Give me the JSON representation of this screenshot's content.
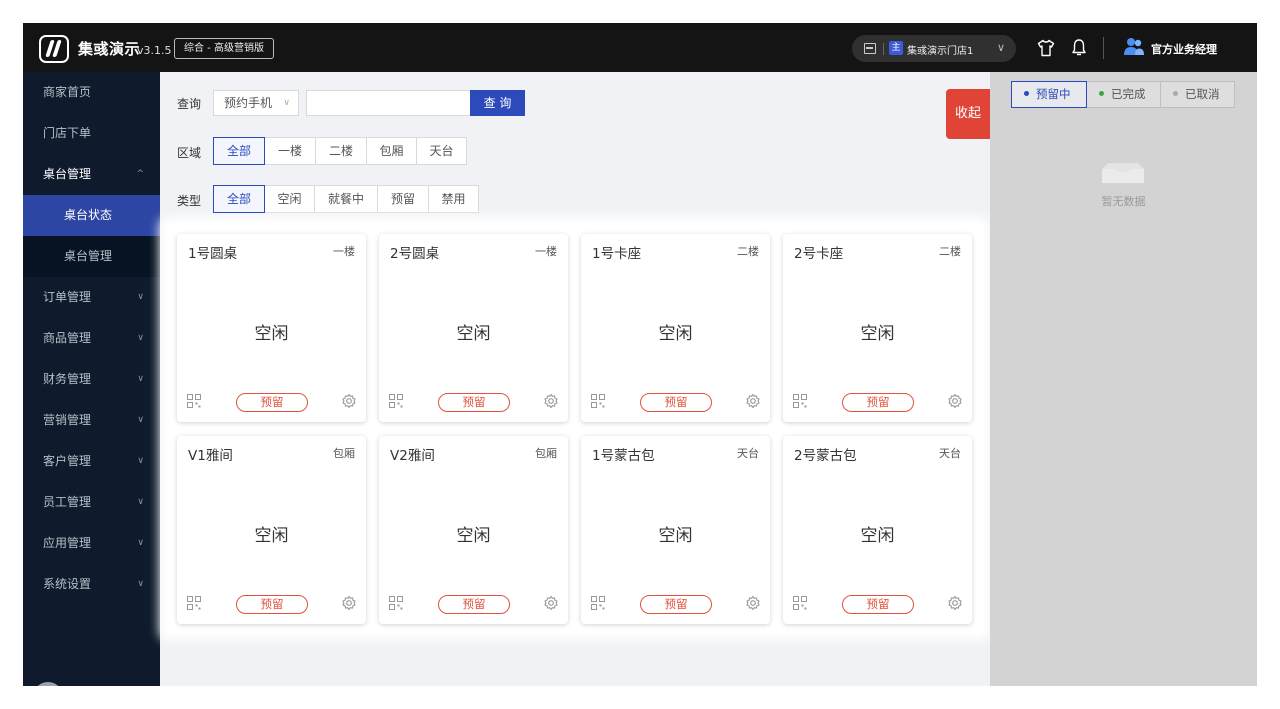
{
  "header": {
    "brand": "集彧演示",
    "version": "v3.1.5",
    "edition": "综合 - 高级营销版",
    "store_badge": "主",
    "store_name": "集彧演示门店1",
    "user_name": "官方业务经理"
  },
  "sidebar": {
    "items": [
      {
        "label": "商家首页"
      },
      {
        "label": "门店下单"
      },
      {
        "label": "桌台管理"
      },
      {
        "label": "桌台状态"
      },
      {
        "label": "桌台管理"
      },
      {
        "label": "订单管理"
      },
      {
        "label": "商品管理"
      },
      {
        "label": "财务管理"
      },
      {
        "label": "营销管理"
      },
      {
        "label": "客户管理"
      },
      {
        "label": "员工管理"
      },
      {
        "label": "应用管理"
      },
      {
        "label": "系统设置"
      }
    ]
  },
  "filters": {
    "query_label": "查询",
    "query_select": "预约手机",
    "search_value": "",
    "search_button": "查 询",
    "area_label": "区域",
    "area_options": [
      "全部",
      "一楼",
      "二楼",
      "包厢",
      "天台"
    ],
    "area_selected": "全部",
    "type_label": "类型",
    "type_options": [
      "全部",
      "空闲",
      "就餐中",
      "预留",
      "禁用"
    ],
    "type_selected": "全部",
    "collapse_label": "收起"
  },
  "tables": [
    {
      "name": "1号圆桌",
      "zone": "一楼",
      "status": "空闲",
      "action": "预留"
    },
    {
      "name": "2号圆桌",
      "zone": "一楼",
      "status": "空闲",
      "action": "预留"
    },
    {
      "name": "1号卡座",
      "zone": "二楼",
      "status": "空闲",
      "action": "预留"
    },
    {
      "name": "2号卡座",
      "zone": "二楼",
      "status": "空闲",
      "action": "预留"
    },
    {
      "name": "V1雅间",
      "zone": "包厢",
      "status": "空闲",
      "action": "预留"
    },
    {
      "name": "V2雅间",
      "zone": "包厢",
      "status": "空闲",
      "action": "预留"
    },
    {
      "name": "1号蒙古包",
      "zone": "天台",
      "status": "空闲",
      "action": "预留"
    },
    {
      "name": "2号蒙古包",
      "zone": "天台",
      "status": "空闲",
      "action": "预留"
    }
  ],
  "right_panel": {
    "tabs": [
      {
        "label": "预留中",
        "dot_color": "#2c4aba"
      },
      {
        "label": "已完成",
        "dot_color": "#3aa54a"
      },
      {
        "label": "已取消",
        "dot_color": "#aaaaaa"
      }
    ],
    "selected_tab": "预留中",
    "empty_text": "暂无数据"
  },
  "colors": {
    "topbar": "#141414",
    "sidebar": "#0f1b2c",
    "accent": "#2c4aba",
    "danger": "#df4436"
  }
}
